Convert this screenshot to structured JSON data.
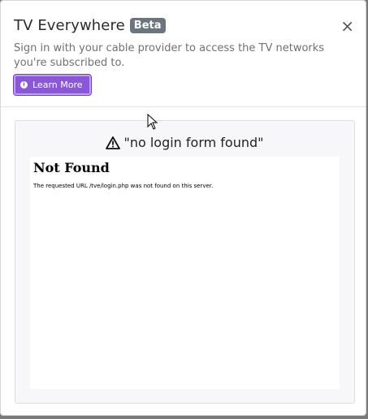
{
  "modal": {
    "title": "TV Everywhere",
    "badge": "Beta",
    "close_label": "×",
    "subtitle": "Sign in with your cable provider to access the TV networks you're subscribed to.",
    "learn_more_label": "Learn More",
    "learn_more_icon": "info-icon"
  },
  "body": {
    "error_message": "\"no login form found\"",
    "error_icon": "warning-icon",
    "frame": {
      "heading": "Not Found",
      "text": "The requested URL /tve/login.php was not found on this server."
    }
  },
  "colors": {
    "accent": "#8a57d6",
    "badge": "#6c757d"
  }
}
